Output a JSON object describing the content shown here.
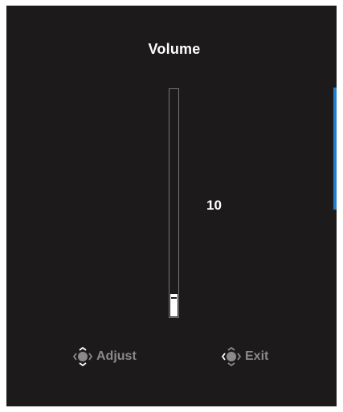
{
  "osd": {
    "title": "Volume",
    "value": "10",
    "level": 10,
    "max": 100
  },
  "hints": {
    "adjust_label": "Adjust",
    "exit_label": "Exit",
    "adjust_icon": "joystick-updown-icon",
    "exit_icon": "joystick-left-icon"
  },
  "colors": {
    "panel": "#1c1a1a",
    "accent": "#1f7fcf",
    "text": "#ffffff",
    "hint_text": "#8a8a8a"
  }
}
